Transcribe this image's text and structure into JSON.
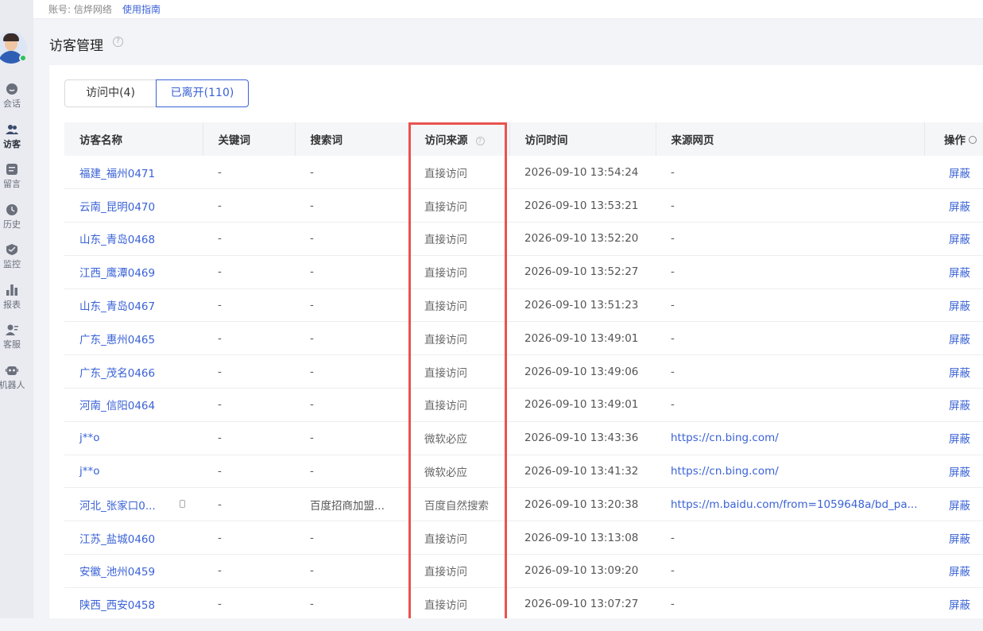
{
  "topbar": {
    "account": "账号: 信烨网络",
    "guide_link": "使用指南"
  },
  "page": {
    "title": "访客管理"
  },
  "sidebar": {
    "items": [
      {
        "label": "会话",
        "icon": "chat-icon"
      },
      {
        "label": "访客",
        "icon": "visitors-icon"
      },
      {
        "label": "留言",
        "icon": "message-icon"
      },
      {
        "label": "历史",
        "icon": "history-icon"
      },
      {
        "label": "监控",
        "icon": "monitor-icon"
      },
      {
        "label": "报表",
        "icon": "report-icon"
      },
      {
        "label": "客服",
        "icon": "agent-icon"
      },
      {
        "label": "机器人",
        "icon": "robot-icon"
      }
    ]
  },
  "tabs": [
    {
      "label": "访问中(4)"
    },
    {
      "label": "已离开(110)"
    }
  ],
  "table": {
    "columns": [
      "访客名称",
      "关键词",
      "搜索词",
      "访问来源",
      "访问时间",
      "来源网页",
      "操作"
    ],
    "rows": [
      {
        "name": "福建_福州0471",
        "keyword": "-",
        "search": "-",
        "source": "直接访问",
        "time": "2026-09-10 13:54:24",
        "url": "-",
        "action": "屏蔽"
      },
      {
        "name": "云南_昆明0470",
        "keyword": "-",
        "search": "-",
        "source": "直接访问",
        "time": "2026-09-10 13:53:21",
        "url": "-",
        "action": "屏蔽"
      },
      {
        "name": "山东_青岛0468",
        "keyword": "-",
        "search": "-",
        "source": "直接访问",
        "time": "2026-09-10 13:52:20",
        "url": "-",
        "action": "屏蔽"
      },
      {
        "name": "江西_鹰潭0469",
        "keyword": "-",
        "search": "-",
        "source": "直接访问",
        "time": "2026-09-10 13:52:27",
        "url": "-",
        "action": "屏蔽"
      },
      {
        "name": "山东_青岛0467",
        "keyword": "-",
        "search": "-",
        "source": "直接访问",
        "time": "2026-09-10 13:51:23",
        "url": "-",
        "action": "屏蔽"
      },
      {
        "name": "广东_惠州0465",
        "keyword": "-",
        "search": "-",
        "source": "直接访问",
        "time": "2026-09-10 13:49:01",
        "url": "-",
        "action": "屏蔽"
      },
      {
        "name": "广东_茂名0466",
        "keyword": "-",
        "search": "-",
        "source": "直接访问",
        "time": "2026-09-10 13:49:06",
        "url": "-",
        "action": "屏蔽"
      },
      {
        "name": "河南_信阳0464",
        "keyword": "-",
        "search": "-",
        "source": "直接访问",
        "time": "2026-09-10 13:49:01",
        "url": "-",
        "action": "屏蔽"
      },
      {
        "name": "j**o",
        "keyword": "-",
        "search": "-",
        "source": "微软必应",
        "time": "2026-09-10 13:43:36",
        "url": "https://cn.bing.com/",
        "action": "屏蔽"
      },
      {
        "name": "j**o",
        "keyword": "-",
        "search": "-",
        "source": "微软必应",
        "time": "2026-09-10 13:41:32",
        "url": "https://cn.bing.com/",
        "action": "屏蔽"
      },
      {
        "name": "河北_张家口0...",
        "keyword": "-",
        "search": "百度招商加盟...",
        "source": "百度自然搜索",
        "time": "2026-09-10 13:20:38",
        "url": "https://m.baidu.com/from=1059648a/bd_pa...",
        "action": "屏蔽"
      },
      {
        "name": "江苏_盐城0460",
        "keyword": "-",
        "search": "-",
        "source": "直接访问",
        "time": "2026-09-10 13:13:08",
        "url": "-",
        "action": "屏蔽"
      },
      {
        "name": "安徽_池州0459",
        "keyword": "-",
        "search": "-",
        "source": "直接访问",
        "time": "2026-09-10 13:09:20",
        "url": "-",
        "action": "屏蔽"
      },
      {
        "name": "陕西_西安0458",
        "keyword": "-",
        "search": "-",
        "source": "直接访问",
        "time": "2026-09-10 13:07:27",
        "url": "-",
        "action": "屏蔽"
      }
    ]
  },
  "colors": {
    "accent": "#3a62d6",
    "highlight": "#e8534e",
    "online": "#2fc25b"
  }
}
